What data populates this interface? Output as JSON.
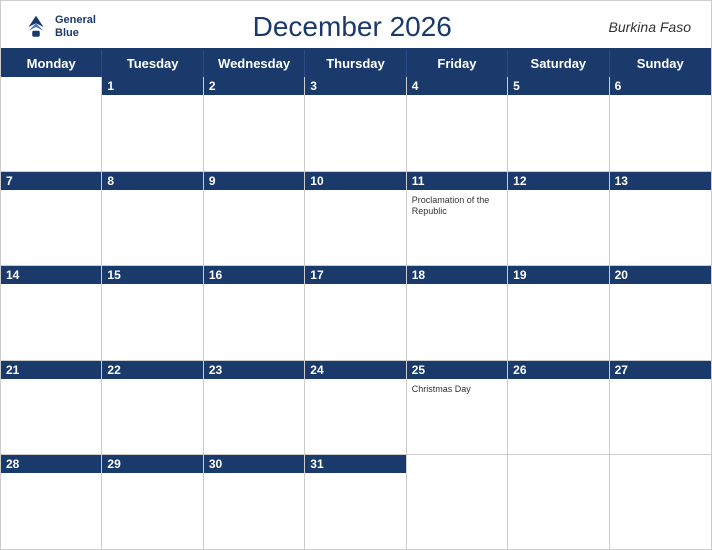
{
  "header": {
    "logo": {
      "line1": "General",
      "line2": "Blue"
    },
    "title": "December 2026",
    "country": "Burkina Faso"
  },
  "dayHeaders": [
    "Monday",
    "Tuesday",
    "Wednesday",
    "Thursday",
    "Friday",
    "Saturday",
    "Sunday"
  ],
  "weeks": [
    [
      {
        "day": "",
        "empty": true
      },
      {
        "day": "1",
        "empty": false
      },
      {
        "day": "2",
        "empty": false
      },
      {
        "day": "3",
        "empty": false
      },
      {
        "day": "4",
        "empty": false
      },
      {
        "day": "5",
        "empty": false
      },
      {
        "day": "6",
        "empty": false
      }
    ],
    [
      {
        "day": "7",
        "empty": false
      },
      {
        "day": "8",
        "empty": false
      },
      {
        "day": "9",
        "empty": false
      },
      {
        "day": "10",
        "empty": false
      },
      {
        "day": "11",
        "empty": false,
        "holiday": "Proclamation of the Republic"
      },
      {
        "day": "12",
        "empty": false
      },
      {
        "day": "13",
        "empty": false
      }
    ],
    [
      {
        "day": "14",
        "empty": false
      },
      {
        "day": "15",
        "empty": false
      },
      {
        "day": "16",
        "empty": false
      },
      {
        "day": "17",
        "empty": false
      },
      {
        "day": "18",
        "empty": false
      },
      {
        "day": "19",
        "empty": false
      },
      {
        "day": "20",
        "empty": false
      }
    ],
    [
      {
        "day": "21",
        "empty": false
      },
      {
        "day": "22",
        "empty": false
      },
      {
        "day": "23",
        "empty": false
      },
      {
        "day": "24",
        "empty": false
      },
      {
        "day": "25",
        "empty": false,
        "holiday": "Christmas Day"
      },
      {
        "day": "26",
        "empty": false
      },
      {
        "day": "27",
        "empty": false
      }
    ],
    [
      {
        "day": "28",
        "empty": false
      },
      {
        "day": "29",
        "empty": false
      },
      {
        "day": "30",
        "empty": false
      },
      {
        "day": "31",
        "empty": false
      },
      {
        "day": "",
        "empty": true
      },
      {
        "day": "",
        "empty": true
      },
      {
        "day": "",
        "empty": true
      }
    ]
  ],
  "colors": {
    "headerBg": "#1a3a6b",
    "headerText": "#ffffff",
    "border": "#cccccc"
  }
}
